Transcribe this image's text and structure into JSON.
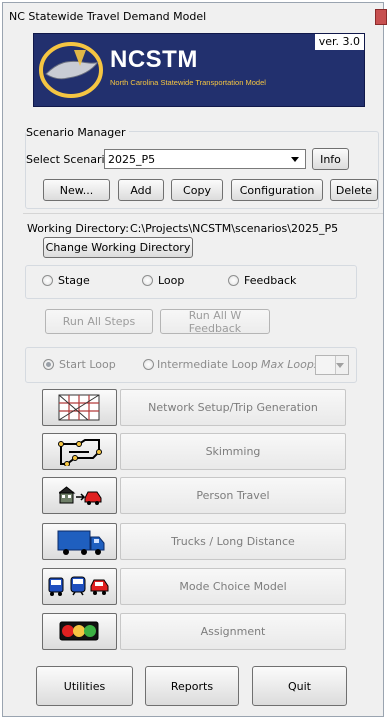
{
  "window": {
    "title": "NC Statewide Travel Demand Model"
  },
  "banner": {
    "acronym": "NCSTM",
    "full_name": "North Carolina Statewide Transportation Model",
    "version": "ver. 3.0",
    "colors": {
      "background": "#22306e",
      "accent": "#f5c542"
    }
  },
  "scenario_manager": {
    "heading": "Scenario Manager",
    "select_label": "Select Scenario",
    "selected_scenario": "2025_P5",
    "info_label": "Info",
    "buttons": {
      "new": "New...",
      "add": "Add",
      "copy": "Copy",
      "configuration": "Configuration",
      "delete": "Delete"
    }
  },
  "working_directory": {
    "label": "Working Directory:",
    "path": "C:\\Projects\\NCSTM\\scenarios\\2025_P5",
    "change_label": "Change Working Directory"
  },
  "run_mode": {
    "stage": "Stage",
    "loop": "Loop",
    "feedback": "Feedback"
  },
  "run_buttons": {
    "run_all_steps": "Run All Steps",
    "run_all_feedback": "Run All W Feedback"
  },
  "loop_options": {
    "start_loop": "Start Loop",
    "intermediate_loop": "Intermediate Loop",
    "max_loops": "Max Loops",
    "start_loop_selected": true
  },
  "steps": [
    {
      "label": "Network Setup/Trip Generation",
      "icon": "network-grid-icon"
    },
    {
      "label": "Skimming",
      "icon": "skim-network-icon"
    },
    {
      "label": "Person Travel",
      "icon": "house-to-car-icon"
    },
    {
      "label": "Trucks / Long Distance",
      "icon": "truck-icon"
    },
    {
      "label": "Mode Choice Model",
      "icon": "bus-train-car-icon"
    },
    {
      "label": "Assignment",
      "icon": "traffic-light-icon"
    }
  ],
  "footer": {
    "utilities": "Utilities",
    "reports": "Reports",
    "quit": "Quit"
  }
}
